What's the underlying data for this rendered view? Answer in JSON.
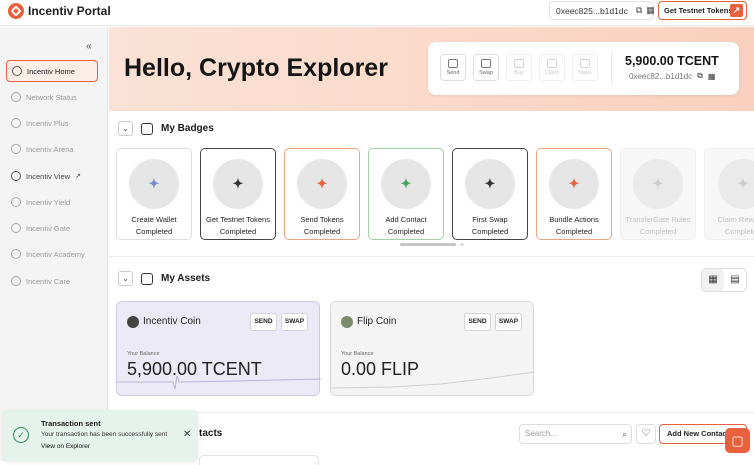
{
  "header": {
    "app_title": "Incentiv Portal",
    "wallet_address": "0xeec825...b1d1dc",
    "testnet_button": "Get Testnet Tokens"
  },
  "sidebar": {
    "items": [
      {
        "label": "Incentiv Home"
      },
      {
        "label": "Network Status"
      },
      {
        "label": "Incentiv Plus"
      },
      {
        "label": "Incentiv Arena"
      },
      {
        "label": "Incentiv View"
      },
      {
        "label": "Incentiv Yield"
      },
      {
        "label": "Incentiv Gate"
      },
      {
        "label": "Incentiv Academy"
      },
      {
        "label": "Incentiv Care"
      }
    ]
  },
  "hero": {
    "title": "Hello, Crypto Explorer",
    "actions": [
      "Send",
      "Swap",
      "Buy",
      "Claim",
      "Stake"
    ],
    "balance": "5,900.00 TCENT",
    "address": "0xeec82...b1d1dc"
  },
  "badges": {
    "title": "My Badges",
    "items": [
      {
        "label": "Create Wallet Completed"
      },
      {
        "label": "Get Testnet Tokens Completed"
      },
      {
        "label": "Send Tokens Completed"
      },
      {
        "label": "Add Contact Completed"
      },
      {
        "label": "First Swap Completed"
      },
      {
        "label": "Bundle Actions Completed"
      },
      {
        "label": "TransferGate Rules Completed"
      },
      {
        "label": "Claim Rewards Completed"
      }
    ]
  },
  "assets": {
    "title": "My Assets",
    "send_label": "SEND",
    "swap_label": "SWAP",
    "balance_label": "Your Balance",
    "coins": [
      {
        "name": "Incentiv Coin",
        "amount": "5,900.00 TCENT"
      },
      {
        "name": "Flip Coin",
        "amount": "0.00 FLIP"
      }
    ]
  },
  "contacts": {
    "title_visible": "tacts",
    "search_placeholder": "Search...",
    "add_button": "Add New Contact"
  },
  "toast": {
    "title": "Transaction sent",
    "description": "Your transaction has been successfully sent",
    "link": "View on Explorer"
  },
  "colors": {
    "accent": "#e8613c",
    "toast_bg": "#e6f3ec"
  }
}
